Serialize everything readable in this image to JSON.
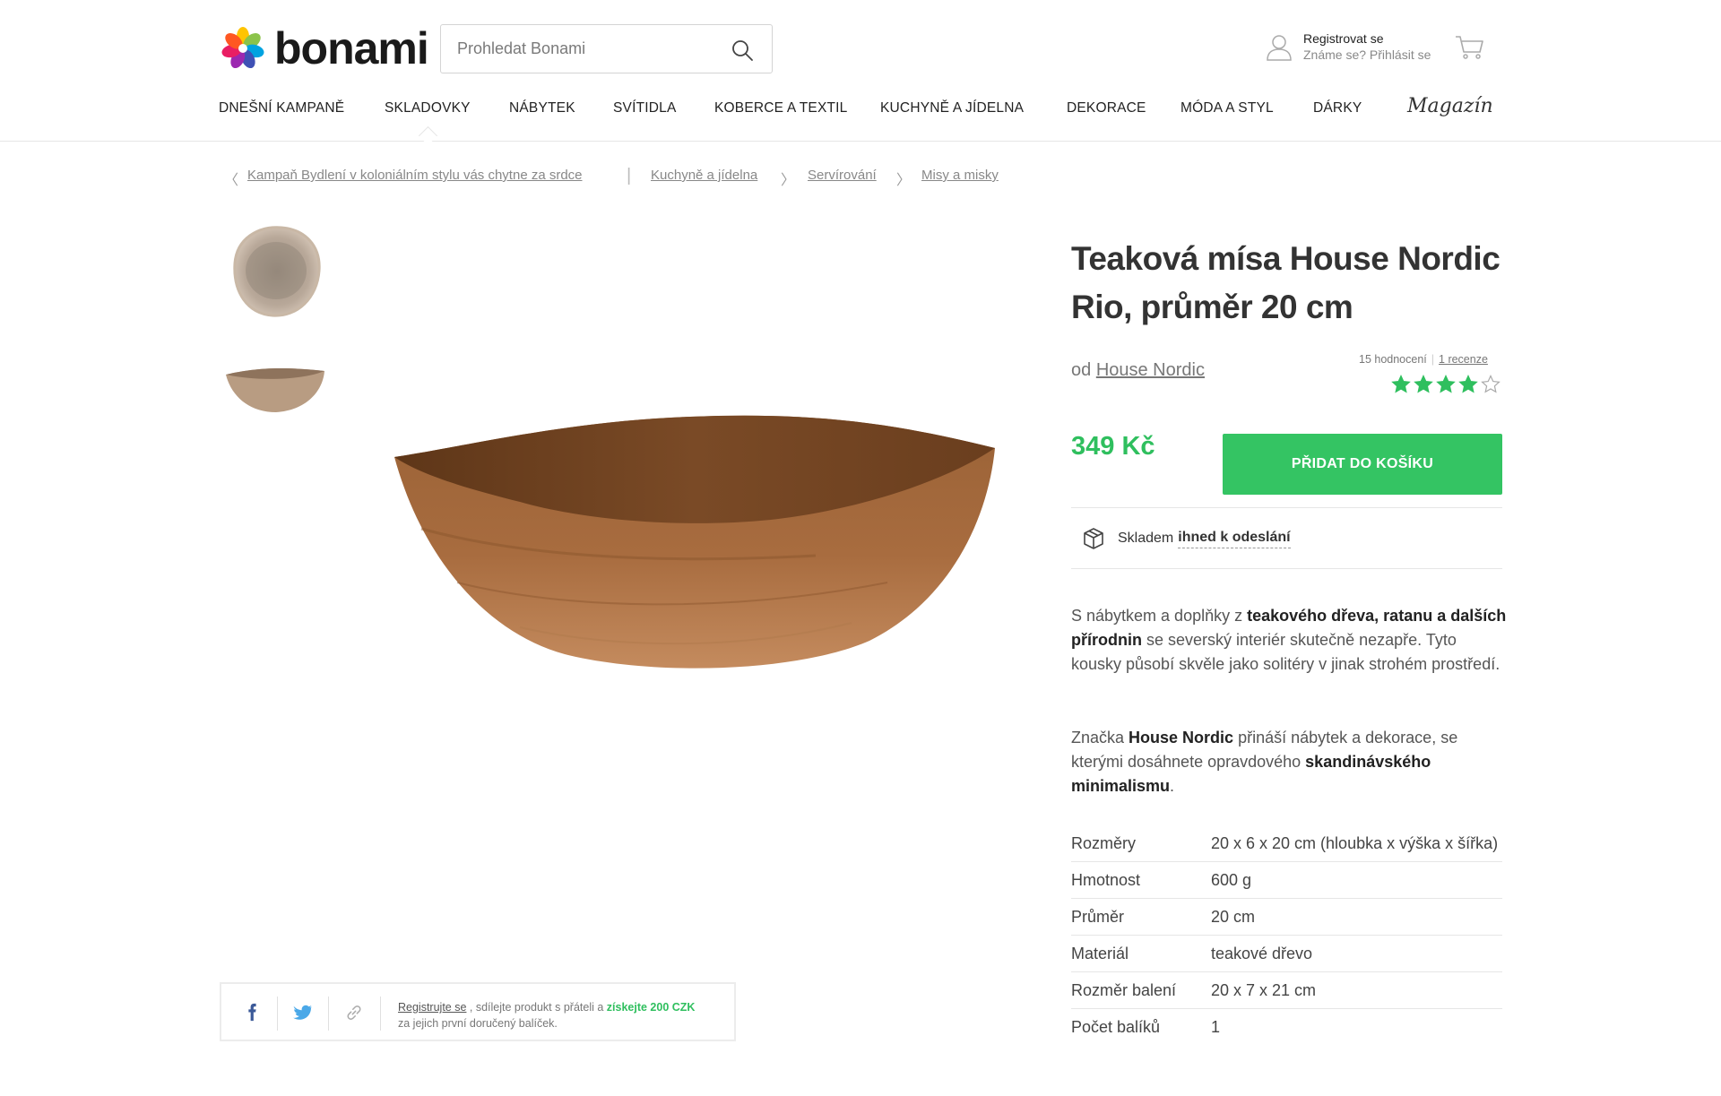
{
  "brand_name": "bonami",
  "search": {
    "placeholder": "Prohledat Bonami"
  },
  "account": {
    "register": "Registrovat se",
    "login": "Známe se? Přihlásit se"
  },
  "nav": [
    {
      "label": "Dnešní kampaně"
    },
    {
      "label": "Skladovky"
    },
    {
      "label": "Nábytek"
    },
    {
      "label": "Svítidla"
    },
    {
      "label": "Koberce a textil"
    },
    {
      "label": "Kuchyně a jídelna"
    },
    {
      "label": "Dekorace"
    },
    {
      "label": "Móda a styl"
    },
    {
      "label": "Dárky"
    }
  ],
  "nav_magazin": "Magazín",
  "breadcrumb": {
    "campaign": "Kampaň Bydlení v koloniálním stylu vás chytne za srdce",
    "items": [
      "Kuchyně a jídelna",
      "Servírování",
      "Misy a misky"
    ]
  },
  "product": {
    "title_line1": "Teaková mísa House Nordic",
    "title_line2": "Rio, průměr 20 cm",
    "by": "od",
    "brand": "House Nordic",
    "ratings_count": "15 hodnocení",
    "reviews": "1 recenze",
    "rating": 4,
    "rating_max": 5,
    "price": "349 Kč",
    "add_to_cart": "PŘIDAT DO KOŠÍKU",
    "stock": "Skladem",
    "shipping": "ihned k odeslání"
  },
  "description": {
    "p1_a": "S nábytkem a doplňky z ",
    "p1_b": "teakového dřeva, ratanu a dalších přírodnin",
    "p1_c": " se severský interiér skutečně nezapře. Tyto kousky působí skvěle jako solitéry v jinak strohém prostředí.",
    "p2_a": "Značka ",
    "p2_b": "House Nordic",
    "p2_c": " přináší nábytek a dekorace, se kterými dosáhnete opravdového ",
    "p2_d": "skandinávského minimalismu",
    "p2_e": "."
  },
  "specs": [
    {
      "key": "Rozměry",
      "value": "20 x 6 x 20 cm (hloubka x výška x šířka)"
    },
    {
      "key": "Hmotnost",
      "value": "600 g"
    },
    {
      "key": "Průměr",
      "value": "20 cm"
    },
    {
      "key": "Materiál",
      "value": "teakové dřevo"
    },
    {
      "key": "Rozměr balení",
      "value": "20 x 7 x 21 cm"
    },
    {
      "key": "Počet balíků",
      "value": "1"
    }
  ],
  "share": {
    "register_link": "Registrujte se",
    "text_a": " , sdílejte produkt s přáteli a ",
    "bonus": "získejte 200 CZK",
    "text_b": "za jejich první doručený balíček."
  },
  "colors": {
    "accent_green": "#34c463",
    "price_green": "#2fbf5e",
    "star_green": "#2fbf5e"
  }
}
